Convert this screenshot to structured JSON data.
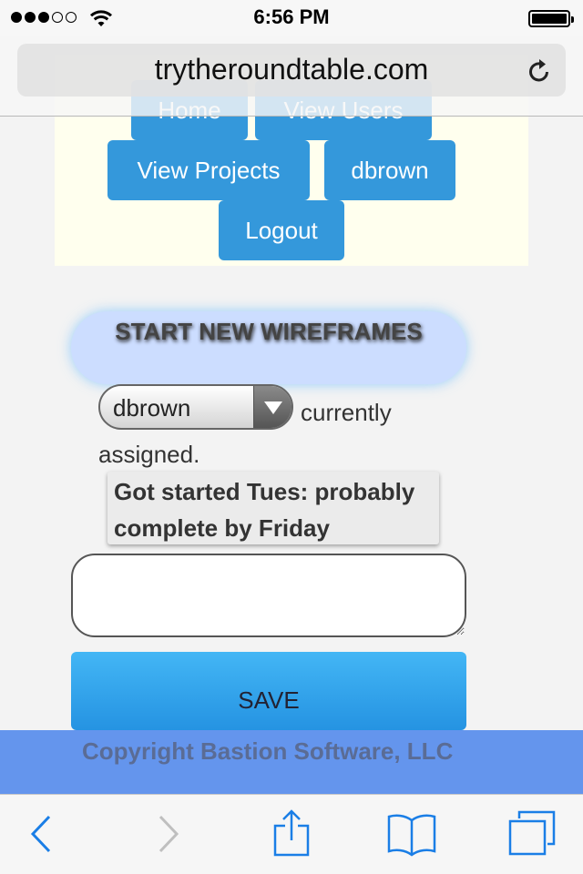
{
  "status_bar": {
    "time": "6:56 PM",
    "signal_bars_filled": 3,
    "signal_bars_total": 5,
    "battery_level": 1.0
  },
  "browser": {
    "url": "trytheroundtable.com"
  },
  "nav": {
    "home": "Home",
    "view_users": "View Users",
    "view_projects": "View Projects",
    "user": "dbrown",
    "logout": "Logout"
  },
  "project": {
    "title": "START NEW WIREFRAMES",
    "assignee": "dbrown",
    "assignment_text": "currently assigned.",
    "note": "Got started Tues: probably complete by Friday",
    "comment_value": "",
    "save_label": "SAVE"
  },
  "footer": {
    "copyright": "Copyright Bastion Software, LLC"
  },
  "colors": {
    "nav_button": "#3498db",
    "nav_panel": "#ffffee",
    "title_pill": "#ccddff",
    "save_button": "#2e9fe8",
    "footer": "#6495ed",
    "ios_tint": "#1a7ee6"
  },
  "icons": {
    "wifi": "wifi-icon",
    "reload": "reload-icon",
    "back": "back-chevron-icon",
    "forward": "forward-chevron-icon",
    "share": "share-icon",
    "bookmarks": "bookmarks-book-icon",
    "tabs": "tabs-icon"
  }
}
